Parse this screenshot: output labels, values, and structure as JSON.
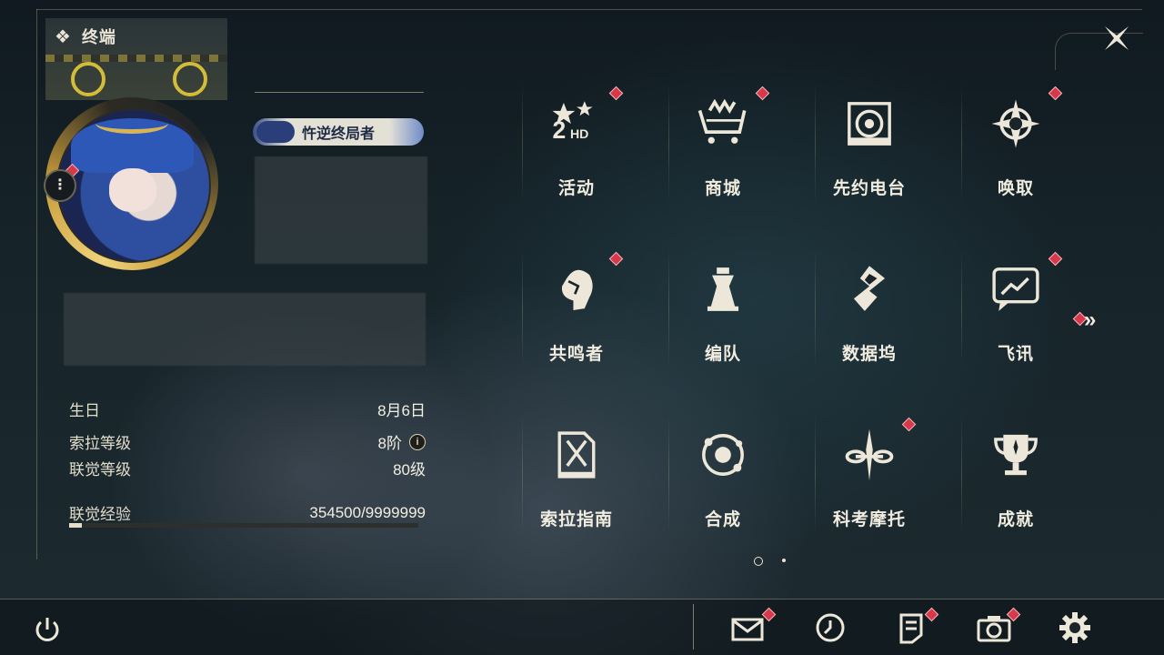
{
  "header": {
    "title": "终端",
    "icon": "diamond-cluster-icon"
  },
  "profile": {
    "badge_text": "忤逆终局者",
    "birthday_label": "生日",
    "birthday_value": "8月6日",
    "sola_level_label": "索拉等级",
    "sola_level_value": "8阶",
    "union_level_label": "联觉等级",
    "union_level_value": "80级",
    "union_xp_label": "联觉经验",
    "union_xp_value": "354500/9999999",
    "union_xp_fraction": 0.0355
  },
  "menu_tiles": [
    {
      "label": "活动",
      "icon": "events-2hd-icon",
      "notify": true
    },
    {
      "label": "商城",
      "icon": "shop-cart-icon",
      "notify": true
    },
    {
      "label": "先约电台",
      "icon": "radio-icon",
      "notify": false
    },
    {
      "label": "唤取",
      "icon": "convene-compass-icon",
      "notify": true
    },
    {
      "label": "共鸣者",
      "icon": "resonator-head-icon",
      "notify": true
    },
    {
      "label": "编队",
      "icon": "team-chess-icon",
      "notify": false
    },
    {
      "label": "数据坞",
      "icon": "data-bank-icon",
      "notify": false
    },
    {
      "label": "飞讯",
      "icon": "message-chat-icon",
      "notify": true
    },
    {
      "label": "索拉指南",
      "icon": "guidebook-icon",
      "notify": false
    },
    {
      "label": "合成",
      "icon": "synthesis-orbit-icon",
      "notify": false
    },
    {
      "label": "科考摩托",
      "icon": "motorcycle-icon",
      "notify": true
    },
    {
      "label": "成就",
      "icon": "trophy-icon",
      "notify": false
    }
  ],
  "pagination": {
    "pages": 2,
    "current": 1
  },
  "bottom_bar": {
    "power": "power-icon",
    "mail": "mail-icon",
    "history": "clock-history-icon",
    "notice": "notice-doc-icon",
    "camera": "camera-icon",
    "settings": "gear-icon"
  },
  "colors": {
    "accent_gold": "#c69b3a",
    "notify_red": "#d8394a",
    "text": "#f1ece0"
  }
}
